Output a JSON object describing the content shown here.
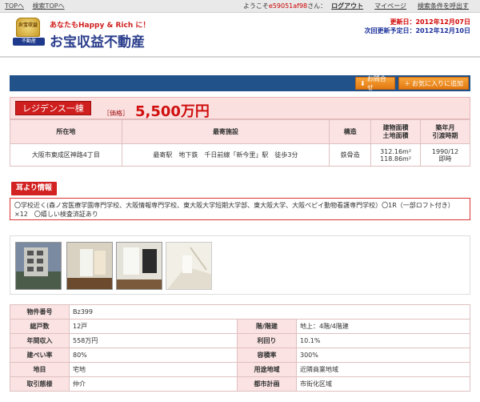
{
  "topbar": {
    "links": [
      "TOPへ",
      "検索TOPへ"
    ],
    "welcome_prefix": "ようこそ",
    "user_id": "e59051af98",
    "welcome_suffix": "さん：",
    "logout": "ログアウト",
    "mypage": "マイページ",
    "saved_search": "検索条件を呼出す"
  },
  "header": {
    "tagline": "あなたもHappy & Rich に！",
    "site_title": "お宝収益不動産",
    "logo_text_top": "お宝収益",
    "logo_text_bottom": "不動産",
    "updated": "更新日：2012年12月07日",
    "next_update": "次回更新予定日：2012年12月10日"
  },
  "actions": {
    "inquiry": "お問合せ",
    "favorite": "お気に入りに追加"
  },
  "property": {
    "type": "レジデンス一棟",
    "price_label": "［価格］",
    "price": "5,500万円"
  },
  "info_table": {
    "headers": [
      "所在地",
      "最寄施設",
      "構造",
      "建物面積\n土地面積",
      "築年月\n引渡時期"
    ],
    "address": "大阪市東成区神路4丁目",
    "station": "最寄駅　地下鉄　千日前線「新今里」駅　徒歩3分",
    "structure": "鉄骨造",
    "building_area": "312.16m²",
    "land_area": "118.86m²",
    "built": "1990/12",
    "delivery": "即時"
  },
  "ears": {
    "badge": "耳より情報",
    "text": "〇学校近く(森ノ宮医療学園専門学校、大阪情報専門学校、東大阪大学短期大学部、東大阪大学、大阪ペピイ動物看護専門学校）〇1R（一部ロフト付き）×12　〇嬉しい検査済証あり"
  },
  "details": {
    "rows": [
      {
        "label": "物件番号",
        "value": "Bz399",
        "label2": "",
        "value2": ""
      },
      {
        "label": "総戸数",
        "value": "12戸",
        "label2": "階/階建",
        "value2": "地上：4階/4階建"
      },
      {
        "label": "年間収入",
        "value": "558万円",
        "label2": "利回り",
        "value2": "10.1%"
      },
      {
        "label": "建ぺい率",
        "value": "80%",
        "label2": "容積率",
        "value2": "300%"
      },
      {
        "label": "地目",
        "value": "宅地",
        "label2": "用途地域",
        "value2": "近隣商業地域"
      },
      {
        "label": "取引態様",
        "value": "仲介",
        "label2": "都市計画",
        "value2": "市街化区域"
      }
    ]
  },
  "colors": {
    "accent_red": "#cf1e1e",
    "navy": "#22528a",
    "orange": "#e37a10",
    "pink": "#fbe3e3"
  }
}
